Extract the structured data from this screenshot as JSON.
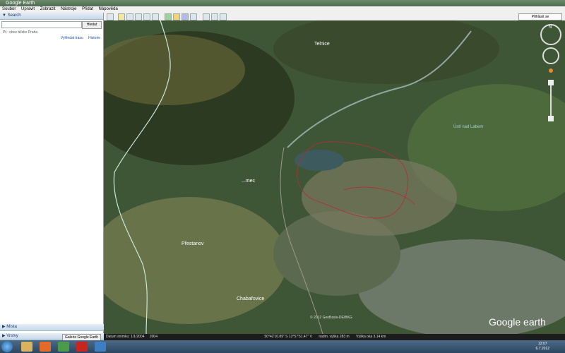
{
  "window": {
    "title": "Google Earth"
  },
  "menu": [
    "Soubor",
    "Upravit",
    "Zobrazit",
    "Nástroje",
    "Přidat",
    "Nápověda"
  ],
  "sidebar": {
    "search_header": "▼ Search",
    "search_placeholder": "",
    "search_button": "Hledat",
    "search_hint": "Př.: obce blízko Praha",
    "links": [
      "Vyhledat trasu",
      "Historie"
    ],
    "places_header": "▶ Místa",
    "layers_header": "▶ Vrstvy",
    "gallery_button": "Galerie Google Earth"
  },
  "toolbar": {
    "signin": "Přihlásit se"
  },
  "map": {
    "labels": [
      {
        "id": "telnice",
        "text": "Telnice"
      },
      {
        "id": "knihov",
        "text": "...mec"
      },
      {
        "id": "pristanov",
        "text": "Přestanov"
      },
      {
        "id": "chabarovice",
        "text": "Chabařovice"
      },
      {
        "id": "ustec",
        "text": "Ústí nad Labem"
      }
    ],
    "compass_label": "N",
    "logo": "Google earth",
    "copyright": "© 2012 GeoBasis-DE/BKG"
  },
  "status": {
    "date": "Datum snímku: 1/1/2004",
    "year": "2004",
    "coords": "50°42'10.89\" S 13°57'51.47\" V",
    "elev": "nadm. výška  283 m",
    "eye": "Výška oka 3.14 km"
  },
  "taskbar": {
    "time": "12:07",
    "date": "6.7.2012"
  },
  "colors": {
    "road": "#c9e8d9",
    "mine_outline": "#b03030",
    "lake": "#3d5a5e",
    "label_text": "#ffffff"
  }
}
